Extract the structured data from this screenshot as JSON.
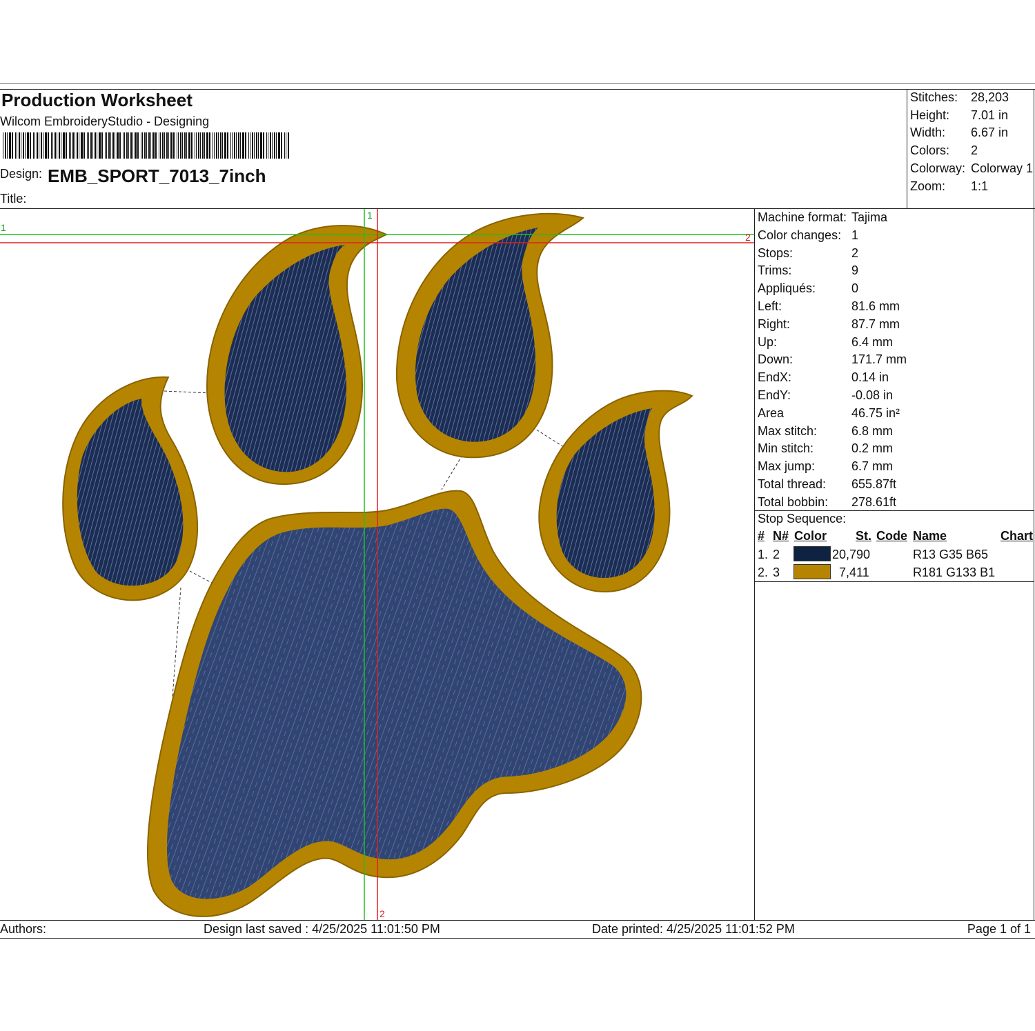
{
  "header": {
    "title": "Production Worksheet",
    "software": "Wilcom EmbroideryStudio - Designing",
    "design_label": "Design:",
    "design_name": "EMB_SPORT_7013_7inch",
    "title_label": "Title:"
  },
  "summary": [
    {
      "label": "Stitches:",
      "value": "28,203"
    },
    {
      "label": "Height:",
      "value": "7.01 in"
    },
    {
      "label": "Width:",
      "value": "6.67 in"
    },
    {
      "label": "Colors:",
      "value": "2"
    },
    {
      "label": "Colorway:",
      "value": "Colorway 1"
    },
    {
      "label": "Zoom:",
      "value": "1:1"
    }
  ],
  "machine_info": [
    {
      "label": "Machine format:",
      "value": "Tajima"
    },
    {
      "label": "Color changes:",
      "value": "1"
    },
    {
      "label": "Stops:",
      "value": "2"
    },
    {
      "label": "Trims:",
      "value": "9"
    },
    {
      "label": "Appliqués:",
      "value": "0"
    },
    {
      "label": "Left:",
      "value": "81.6 mm"
    },
    {
      "label": "Right:",
      "value": "87.7 mm"
    },
    {
      "label": "Up:",
      "value": "6.4 mm"
    },
    {
      "label": "Down:",
      "value": "171.7 mm"
    },
    {
      "label": "EndX:",
      "value": "0.14 in"
    },
    {
      "label": "EndY:",
      "value": "-0.08 in"
    },
    {
      "label": "Area",
      "value": " 46.75 in²"
    },
    {
      "label": "Max stitch:",
      "value": "6.8 mm"
    },
    {
      "label": "Min stitch:",
      "value": "0.2 mm"
    },
    {
      "label": "Max jump:",
      "value": "6.7 mm"
    },
    {
      "label": "Total thread:",
      "value": "655.87ft"
    },
    {
      "label": "Total bobbin:",
      "value": "278.61ft"
    }
  ],
  "stop_sequence": {
    "title": "Stop Sequence:",
    "headers": {
      "num": "#",
      "needle": "N#",
      "color": "Color",
      "stitches": "St.",
      "code": "Code",
      "name": "Name",
      "chart": "Chart"
    },
    "rows": [
      {
        "num": "1.",
        "needle": "2",
        "color": "#0d2341",
        "stitches": "20,790",
        "name": "R13 G35 B65"
      },
      {
        "num": "2.",
        "needle": "3",
        "color": "#b58501",
        "stitches": "7,411",
        "name": "R181 G133 B1"
      }
    ]
  },
  "canvas": {
    "guide_h1_label": "1",
    "guide_v1_label": "1",
    "guide_h2_label": "2",
    "guide_v2_label": "2",
    "thread_navy": "#1b2d55",
    "thread_gold": "#b58501"
  },
  "footer": {
    "authors": "Authors:",
    "saved": "Design last saved : 4/25/2025 11:01:50 PM",
    "printed": "Date printed: 4/25/2025 11:01:52 PM",
    "page": "Page 1 of 1"
  }
}
